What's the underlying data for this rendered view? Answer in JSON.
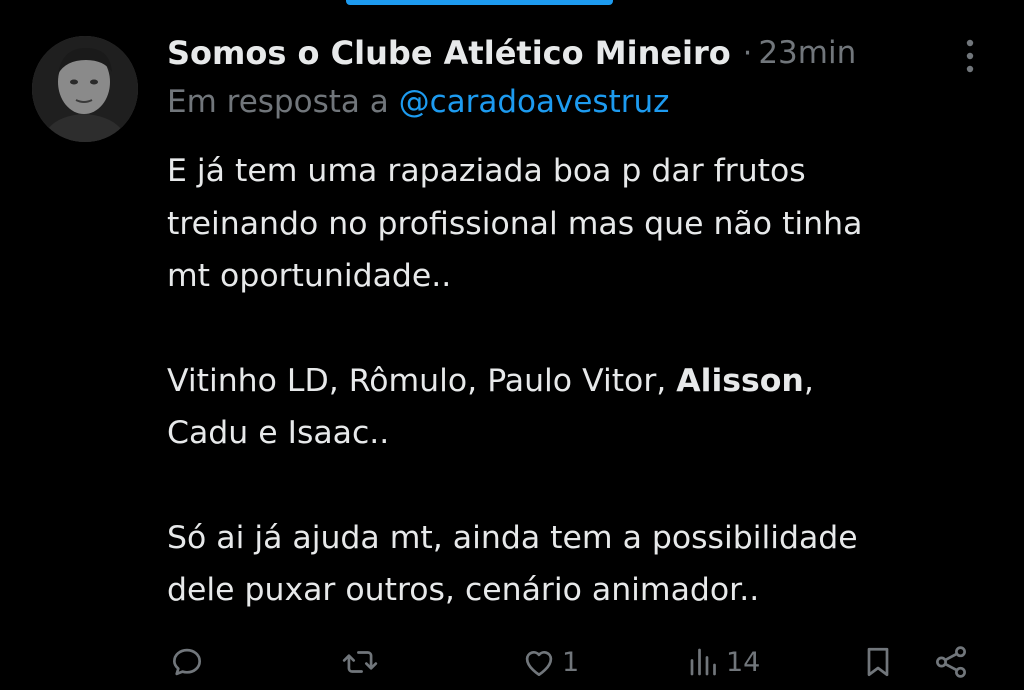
{
  "post": {
    "author_name": "Somos o Clube Atlético Mineiro",
    "separator": "·",
    "timestamp": "23min",
    "reply_prefix": "Em resposta a",
    "reply_handle": "@caradoavestruz",
    "lines": {
      "l1": "E já tem uma rapaziada boa p dar frutos",
      "l2": "treinando no profissional mas que não tinha",
      "l3": "mt oportunidade..",
      "l4_before": "Vitinho LD, Rômulo, Paulo Vitor, ",
      "l4_bold": "Alisson",
      "l4_after": ",",
      "l5": "Cadu e Isaac..",
      "l6": "Só ai já ajuda mt, ainda tem a possibilidade",
      "l7": "dele puxar outros, cenário animador.."
    }
  },
  "actions": {
    "reply_icon": "reply-icon",
    "repost_icon": "repost-icon",
    "like_icon": "heart-icon",
    "like_count": "1",
    "views_icon": "views-icon",
    "views_count": "14",
    "bookmark_icon": "bookmark-icon",
    "share_icon": "share-icon"
  },
  "colors": {
    "background": "#000000",
    "text": "#e7e9ea",
    "muted": "#71767b",
    "accent": "#1d9bf0"
  }
}
